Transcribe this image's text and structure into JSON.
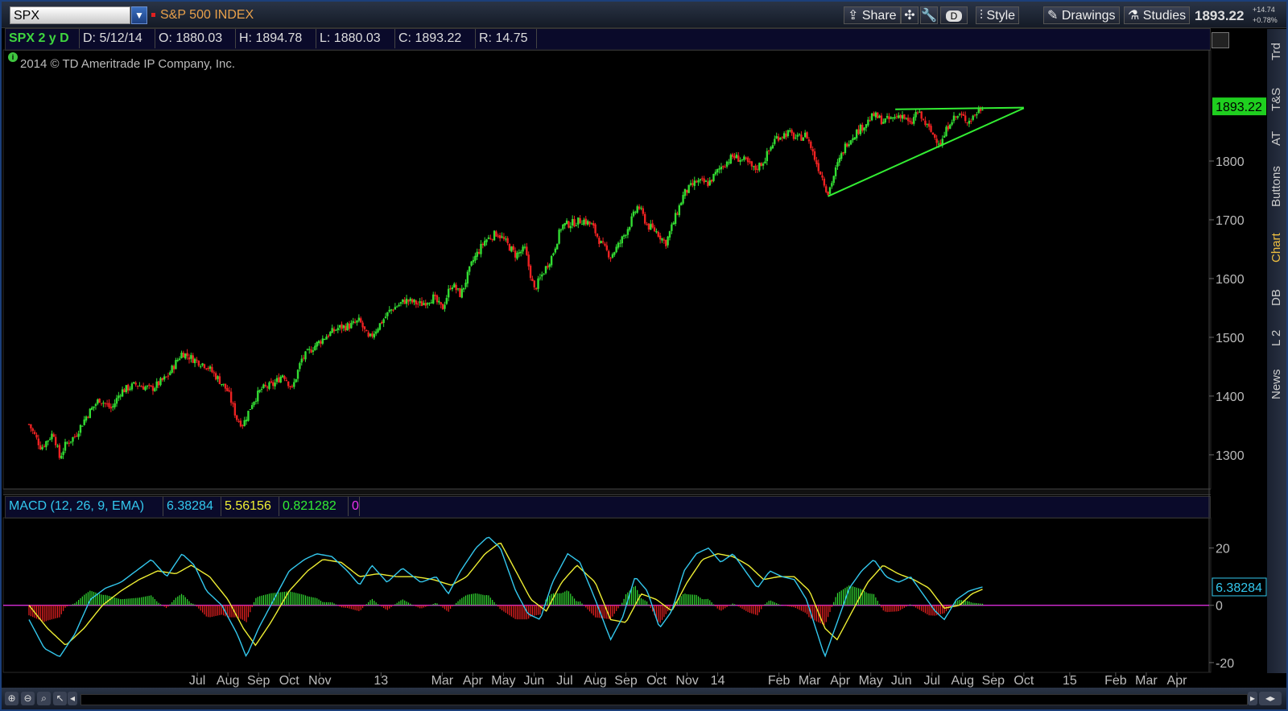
{
  "toolbar": {
    "symbol": "SPX",
    "index_name": "S&P 500 INDEX",
    "share_label": "Share",
    "d_label": "D",
    "style_label": "Style",
    "drawings_label": "Drawings",
    "studies_label": "Studies",
    "last_price": "1893.22",
    "change_abs": "+14.74",
    "change_pct": "+0.78%"
  },
  "infobar": {
    "label": "SPX 2 y D",
    "date": "D: 5/12/14",
    "open": "O: 1880.03",
    "high": "H: 1894.78",
    "low": "L: 1880.03",
    "close": "C: 1893.22",
    "range": "R: 14.75"
  },
  "copyright": "2014 © TD Ameritrade IP Company, Inc.",
  "macd_header": {
    "label": "MACD (12, 26, 9, EMA)",
    "value": "6.38284",
    "avg": "5.56156",
    "diff": "0.821282",
    "zero": "0"
  },
  "side_tabs": [
    "Trd",
    "T&S",
    "AT",
    "Buttons",
    "Chart",
    "DB",
    "L 2",
    "News"
  ],
  "colors": {
    "up": "#33dd33",
    "down": "#ee2222",
    "macd_line": "#33c8ee",
    "avg_line": "#eeee33",
    "zero_line": "#ee33ee",
    "trend_line": "#33ee33",
    "axis_text": "#c88a3a"
  },
  "chart_data": [
    {
      "type": "candlestick",
      "title": "SPX 2 y D",
      "price_label": "1893.22",
      "ylim": [
        1245,
        1985
      ],
      "y_ticks": [
        1300,
        1400,
        1500,
        1600,
        1700,
        1800
      ],
      "x_tick_labels": [
        "Jul",
        "Aug",
        "Sep",
        "Oct",
        "Nov",
        "13",
        "Mar",
        "Apr",
        "May",
        "Jun",
        "Jul",
        "Aug",
        "Sep",
        "Oct",
        "Nov",
        "14",
        "Feb",
        "Mar",
        "Apr",
        "May",
        "Jun",
        "Jul",
        "Aug",
        "Sep",
        "Oct",
        "15",
        "Feb",
        "Mar",
        "Apr"
      ],
      "x_tick_months": [
        5.5,
        6.5,
        7.5,
        8.5,
        9.5,
        11.5,
        13.5,
        14.5,
        15.5,
        16.5,
        17.5,
        18.5,
        19.5,
        20.5,
        21.5,
        22.5,
        24.5,
        25.5,
        26.5,
        27.5,
        28.5,
        29.5,
        30.5,
        31.5,
        32.5,
        34,
        35.5,
        36.5,
        37.5
      ],
      "close_path": [
        {
          "t": 0.0,
          "v": 1352
        },
        {
          "t": 0.4,
          "v": 1312
        },
        {
          "t": 0.8,
          "v": 1338
        },
        {
          "t": 1.0,
          "v": 1295
        },
        {
          "t": 1.2,
          "v": 1318
        },
        {
          "t": 1.5,
          "v": 1332
        },
        {
          "t": 1.9,
          "v": 1368
        },
        {
          "t": 2.3,
          "v": 1395
        },
        {
          "t": 2.7,
          "v": 1378
        },
        {
          "t": 3.0,
          "v": 1408
        },
        {
          "t": 3.5,
          "v": 1420
        },
        {
          "t": 4.0,
          "v": 1412
        },
        {
          "t": 4.5,
          "v": 1432
        },
        {
          "t": 5.0,
          "v": 1474
        },
        {
          "t": 5.4,
          "v": 1462
        },
        {
          "t": 5.8,
          "v": 1452
        },
        {
          "t": 6.2,
          "v": 1428
        },
        {
          "t": 6.5,
          "v": 1408
        },
        {
          "t": 6.8,
          "v": 1360
        },
        {
          "t": 7.0,
          "v": 1352
        },
        {
          "t": 7.3,
          "v": 1390
        },
        {
          "t": 7.6,
          "v": 1412
        },
        {
          "t": 8.0,
          "v": 1420
        },
        {
          "t": 8.3,
          "v": 1438
        },
        {
          "t": 8.6,
          "v": 1412
        },
        {
          "t": 8.9,
          "v": 1462
        },
        {
          "t": 9.3,
          "v": 1484
        },
        {
          "t": 9.7,
          "v": 1502
        },
        {
          "t": 10.1,
          "v": 1516
        },
        {
          "t": 10.5,
          "v": 1520
        },
        {
          "t": 10.8,
          "v": 1528
        },
        {
          "t": 11.1,
          "v": 1496
        },
        {
          "t": 11.4,
          "v": 1518
        },
        {
          "t": 11.8,
          "v": 1546
        },
        {
          "t": 12.3,
          "v": 1563
        },
        {
          "t": 12.8,
          "v": 1556
        },
        {
          "t": 13.2,
          "v": 1568
        },
        {
          "t": 13.5,
          "v": 1548
        },
        {
          "t": 13.8,
          "v": 1592
        },
        {
          "t": 14.1,
          "v": 1572
        },
        {
          "t": 14.5,
          "v": 1630
        },
        {
          "t": 14.9,
          "v": 1665
        },
        {
          "t": 15.3,
          "v": 1678
        },
        {
          "t": 15.6,
          "v": 1660
        },
        {
          "t": 15.9,
          "v": 1640
        },
        {
          "t": 16.2,
          "v": 1650
        },
        {
          "t": 16.5,
          "v": 1580
        },
        {
          "t": 16.8,
          "v": 1610
        },
        {
          "t": 17.1,
          "v": 1640
        },
        {
          "t": 17.4,
          "v": 1690
        },
        {
          "t": 17.8,
          "v": 1695
        },
        {
          "t": 18.1,
          "v": 1700
        },
        {
          "t": 18.4,
          "v": 1690
        },
        {
          "t": 18.7,
          "v": 1658
        },
        {
          "t": 19.0,
          "v": 1638
        },
        {
          "t": 19.3,
          "v": 1660
        },
        {
          "t": 19.6,
          "v": 1690
        },
        {
          "t": 19.9,
          "v": 1725
        },
        {
          "t": 20.2,
          "v": 1690
        },
        {
          "t": 20.5,
          "v": 1680
        },
        {
          "t": 20.8,
          "v": 1660
        },
        {
          "t": 21.1,
          "v": 1702
        },
        {
          "t": 21.4,
          "v": 1745
        },
        {
          "t": 21.8,
          "v": 1765
        },
        {
          "t": 22.2,
          "v": 1762
        },
        {
          "t": 22.6,
          "v": 1790
        },
        {
          "t": 23.0,
          "v": 1808
        },
        {
          "t": 23.4,
          "v": 1800
        },
        {
          "t": 23.7,
          "v": 1785
        },
        {
          "t": 24.0,
          "v": 1800
        },
        {
          "t": 24.4,
          "v": 1840
        },
        {
          "t": 24.8,
          "v": 1848
        },
        {
          "t": 25.1,
          "v": 1838
        },
        {
          "t": 25.4,
          "v": 1845
        },
        {
          "t": 25.7,
          "v": 1800
        },
        {
          "t": 25.9,
          "v": 1775
        },
        {
          "t": 26.1,
          "v": 1745
        },
        {
          "t": 26.4,
          "v": 1792
        },
        {
          "t": 26.7,
          "v": 1830
        },
        {
          "t": 27.0,
          "v": 1848
        },
        {
          "t": 27.3,
          "v": 1862
        },
        {
          "t": 27.6,
          "v": 1878
        },
        {
          "t": 27.9,
          "v": 1868
        },
        {
          "t": 28.2,
          "v": 1872
        },
        {
          "t": 28.5,
          "v": 1880
        },
        {
          "t": 28.8,
          "v": 1860
        },
        {
          "t": 29.0,
          "v": 1885
        },
        {
          "t": 29.3,
          "v": 1862
        },
        {
          "t": 29.6,
          "v": 1840
        },
        {
          "t": 29.8,
          "v": 1830
        },
        {
          "t": 30.1,
          "v": 1870
        },
        {
          "t": 30.4,
          "v": 1878
        },
        {
          "t": 30.7,
          "v": 1868
        },
        {
          "t": 30.95,
          "v": 1882
        },
        {
          "t": 31.15,
          "v": 1893
        }
      ],
      "trend_lines": [
        {
          "t1": 26.1,
          "v1": 1740,
          "t2": 32.5,
          "v2": 1890
        },
        {
          "t1": 28.3,
          "v1": 1888,
          "t2": 32.5,
          "v2": 1891
        }
      ]
    },
    {
      "type": "macd",
      "title": "MACD (12, 26, 9, EMA)",
      "value_label": "6.38284",
      "ylim": [
        -22,
        30
      ],
      "y_ticks": [
        20,
        0,
        -20
      ],
      "macd_path": [
        {
          "t": 0.0,
          "v": -5
        },
        {
          "t": 0.5,
          "v": -15
        },
        {
          "t": 1.0,
          "v": -18
        },
        {
          "t": 1.5,
          "v": -10
        },
        {
          "t": 2.0,
          "v": 2
        },
        {
          "t": 2.5,
          "v": 6
        },
        {
          "t": 3.0,
          "v": 8
        },
        {
          "t": 3.5,
          "v": 12
        },
        {
          "t": 4.0,
          "v": 16
        },
        {
          "t": 4.5,
          "v": 10
        },
        {
          "t": 5.0,
          "v": 18
        },
        {
          "t": 5.4,
          "v": 14
        },
        {
          "t": 5.8,
          "v": 5
        },
        {
          "t": 6.3,
          "v": 0
        },
        {
          "t": 6.8,
          "v": -10
        },
        {
          "t": 7.1,
          "v": -18
        },
        {
          "t": 7.5,
          "v": -8
        },
        {
          "t": 8.0,
          "v": 2
        },
        {
          "t": 8.5,
          "v": 12
        },
        {
          "t": 9.0,
          "v": 16
        },
        {
          "t": 9.4,
          "v": 18
        },
        {
          "t": 9.9,
          "v": 17
        },
        {
          "t": 10.4,
          "v": 12
        },
        {
          "t": 10.8,
          "v": 7
        },
        {
          "t": 11.2,
          "v": 14
        },
        {
          "t": 11.7,
          "v": 8
        },
        {
          "t": 12.2,
          "v": 13
        },
        {
          "t": 12.8,
          "v": 8
        },
        {
          "t": 13.3,
          "v": 10
        },
        {
          "t": 13.7,
          "v": 4
        },
        {
          "t": 14.1,
          "v": 12
        },
        {
          "t": 14.6,
          "v": 20
        },
        {
          "t": 15.0,
          "v": 24
        },
        {
          "t": 15.4,
          "v": 20
        },
        {
          "t": 15.9,
          "v": 5
        },
        {
          "t": 16.3,
          "v": -3
        },
        {
          "t": 16.7,
          "v": -5
        },
        {
          "t": 17.1,
          "v": 8
        },
        {
          "t": 17.6,
          "v": 18
        },
        {
          "t": 18.0,
          "v": 15
        },
        {
          "t": 18.5,
          "v": 2
        },
        {
          "t": 19.0,
          "v": -12
        },
        {
          "t": 19.4,
          "v": -4
        },
        {
          "t": 19.8,
          "v": 10
        },
        {
          "t": 20.2,
          "v": 5
        },
        {
          "t": 20.6,
          "v": -8
        },
        {
          "t": 21.0,
          "v": -2
        },
        {
          "t": 21.4,
          "v": 12
        },
        {
          "t": 21.8,
          "v": 18
        },
        {
          "t": 22.2,
          "v": 20
        },
        {
          "t": 22.6,
          "v": 15
        },
        {
          "t": 23.0,
          "v": 18
        },
        {
          "t": 23.4,
          "v": 12
        },
        {
          "t": 23.8,
          "v": 6
        },
        {
          "t": 24.2,
          "v": 12
        },
        {
          "t": 24.6,
          "v": 10
        },
        {
          "t": 25.0,
          "v": 9
        },
        {
          "t": 25.4,
          "v": 2
        },
        {
          "t": 25.7,
          "v": -8
        },
        {
          "t": 26.0,
          "v": -18
        },
        {
          "t": 26.4,
          "v": -6
        },
        {
          "t": 26.8,
          "v": 6
        },
        {
          "t": 27.2,
          "v": 12
        },
        {
          "t": 27.6,
          "v": 16
        },
        {
          "t": 28.0,
          "v": 10
        },
        {
          "t": 28.4,
          "v": 8
        },
        {
          "t": 28.8,
          "v": 10
        },
        {
          "t": 29.2,
          "v": 4
        },
        {
          "t": 29.6,
          "v": -2
        },
        {
          "t": 29.9,
          "v": -5
        },
        {
          "t": 30.3,
          "v": 2
        },
        {
          "t": 30.7,
          "v": 5
        },
        {
          "t": 31.15,
          "v": 6.4
        }
      ],
      "avg_path": [
        {
          "t": 0.0,
          "v": 0
        },
        {
          "t": 0.6,
          "v": -8
        },
        {
          "t": 1.2,
          "v": -14
        },
        {
          "t": 1.8,
          "v": -8
        },
        {
          "t": 2.4,
          "v": 0
        },
        {
          "t": 3.0,
          "v": 5
        },
        {
          "t": 3.6,
          "v": 9
        },
        {
          "t": 4.2,
          "v": 12
        },
        {
          "t": 4.8,
          "v": 11
        },
        {
          "t": 5.3,
          "v": 14
        },
        {
          "t": 5.9,
          "v": 10
        },
        {
          "t": 6.5,
          "v": 2
        },
        {
          "t": 7.0,
          "v": -8
        },
        {
          "t": 7.4,
          "v": -14
        },
        {
          "t": 7.9,
          "v": -6
        },
        {
          "t": 8.5,
          "v": 5
        },
        {
          "t": 9.1,
          "v": 12
        },
        {
          "t": 9.6,
          "v": 16
        },
        {
          "t": 10.2,
          "v": 15
        },
        {
          "t": 10.8,
          "v": 10
        },
        {
          "t": 11.4,
          "v": 11
        },
        {
          "t": 12.0,
          "v": 10
        },
        {
          "t": 12.6,
          "v": 10
        },
        {
          "t": 13.2,
          "v": 9
        },
        {
          "t": 13.8,
          "v": 7
        },
        {
          "t": 14.3,
          "v": 10
        },
        {
          "t": 14.9,
          "v": 18
        },
        {
          "t": 15.4,
          "v": 22
        },
        {
          "t": 15.9,
          "v": 12
        },
        {
          "t": 16.4,
          "v": 2
        },
        {
          "t": 16.9,
          "v": -2
        },
        {
          "t": 17.4,
          "v": 8
        },
        {
          "t": 17.9,
          "v": 14
        },
        {
          "t": 18.5,
          "v": 8
        },
        {
          "t": 19.0,
          "v": -5
        },
        {
          "t": 19.5,
          "v": -6
        },
        {
          "t": 20.0,
          "v": 4
        },
        {
          "t": 20.5,
          "v": 2
        },
        {
          "t": 21.0,
          "v": -2
        },
        {
          "t": 21.5,
          "v": 8
        },
        {
          "t": 22.0,
          "v": 16
        },
        {
          "t": 22.5,
          "v": 18
        },
        {
          "t": 23.0,
          "v": 17
        },
        {
          "t": 23.5,
          "v": 14
        },
        {
          "t": 24.0,
          "v": 9
        },
        {
          "t": 24.5,
          "v": 10
        },
        {
          "t": 25.0,
          "v": 10
        },
        {
          "t": 25.5,
          "v": 5
        },
        {
          "t": 26.0,
          "v": -8
        },
        {
          "t": 26.4,
          "v": -12
        },
        {
          "t": 26.9,
          "v": -2
        },
        {
          "t": 27.4,
          "v": 8
        },
        {
          "t": 27.9,
          "v": 14
        },
        {
          "t": 28.4,
          "v": 11
        },
        {
          "t": 28.9,
          "v": 9
        },
        {
          "t": 29.4,
          "v": 6
        },
        {
          "t": 29.9,
          "v": -1
        },
        {
          "t": 30.4,
          "v": 0
        },
        {
          "t": 30.8,
          "v": 4
        },
        {
          "t": 31.15,
          "v": 5.6
        }
      ]
    }
  ]
}
